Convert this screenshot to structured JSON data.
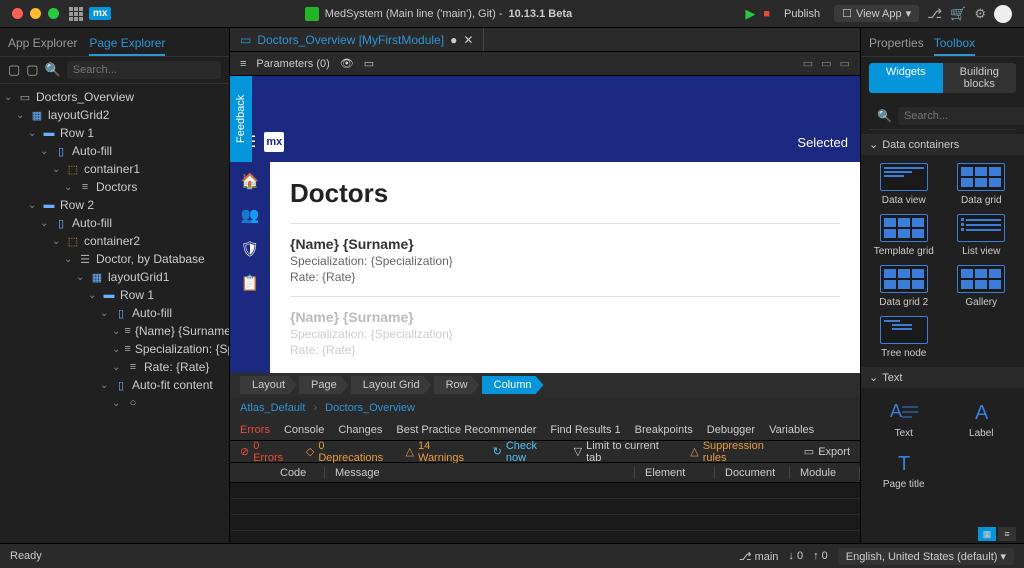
{
  "titlebar": {
    "project": "MedSystem (Main line ('main'), Git) -",
    "version": "10.13.1 Beta",
    "publish": "Publish",
    "view_app": "View App"
  },
  "left": {
    "tabs": [
      "App Explorer",
      "Page Explorer"
    ],
    "active_tab": 1,
    "search_placeholder": "Search...",
    "tree": [
      {
        "d": 0,
        "icon": "page",
        "label": "Doctors_Overview"
      },
      {
        "d": 1,
        "icon": "grid",
        "label": "layoutGrid2"
      },
      {
        "d": 2,
        "icon": "row",
        "label": "Row 1"
      },
      {
        "d": 3,
        "icon": "col",
        "label": "Auto-fill"
      },
      {
        "d": 4,
        "icon": "cont",
        "label": "container1"
      },
      {
        "d": 5,
        "icon": "text",
        "label": "Doctors"
      },
      {
        "d": 2,
        "icon": "row",
        "label": "Row 2"
      },
      {
        "d": 3,
        "icon": "col",
        "label": "Auto-fill"
      },
      {
        "d": 4,
        "icon": "cont",
        "label": "container2"
      },
      {
        "d": 5,
        "icon": "data",
        "label": "Doctor, by Database"
      },
      {
        "d": 6,
        "icon": "grid",
        "label": "layoutGrid1"
      },
      {
        "d": 7,
        "icon": "row",
        "label": "Row 1"
      },
      {
        "d": 8,
        "icon": "col",
        "label": "Auto-fill"
      },
      {
        "d": 9,
        "icon": "text",
        "label": "{Name} {Surname}"
      },
      {
        "d": 9,
        "icon": "text",
        "label": "Specialization: {Specializ"
      },
      {
        "d": 9,
        "icon": "text",
        "label": "Rate: {Rate}"
      },
      {
        "d": 8,
        "icon": "col",
        "label": "Auto-fit content"
      },
      {
        "d": 9,
        "icon": "circle",
        "label": ""
      }
    ]
  },
  "doc": {
    "tab": "Doctors_Overview [MyFirstModule]",
    "params": "Parameters (0)"
  },
  "canvas": {
    "feedback": "Feedback",
    "selected": "Selected",
    "page_title": "Doctors",
    "cards": [
      {
        "title": "{Name} {Surname}",
        "spec": "Specialization: {Specialization}",
        "rate": "Rate: {Rate}",
        "faded": false
      },
      {
        "title": "{Name} {Surname}",
        "spec": "Specialization: {Specialization}",
        "rate": "Rate: {Rate}",
        "faded": true
      }
    ]
  },
  "breadcrumb": [
    "Layout",
    "Page",
    "Layout Grid",
    "Row",
    "Column"
  ],
  "refs": {
    "atlas": "Atlas_Default",
    "page": "Doctors_Overview"
  },
  "bottom_tabs": [
    "Errors",
    "Console",
    "Changes",
    "Best Practice Recommender",
    "Find Results 1",
    "Breakpoints",
    "Debugger",
    "Variables"
  ],
  "bottom_active": 0,
  "errors": {
    "errors": "0 Errors",
    "deprecations": "0 Deprecations",
    "warnings": "14 Warnings",
    "check": "Check now",
    "limit": "Limit to current tab",
    "suppress": "Suppression rules",
    "export": "Export"
  },
  "table_cols": [
    "",
    "Code",
    "Message",
    "Element",
    "Document",
    "Module"
  ],
  "right": {
    "tabs": [
      "Properties",
      "Toolbox"
    ],
    "active_tab": 1,
    "pills": [
      "Widgets",
      "Building blocks"
    ],
    "active_pill": 0,
    "search_placeholder": "Search...",
    "sections": [
      {
        "title": "Data containers",
        "items": [
          {
            "name": "Data view",
            "kind": "view"
          },
          {
            "name": "Data grid",
            "kind": "grid"
          },
          {
            "name": "Template grid",
            "kind": "tgrid"
          },
          {
            "name": "List view",
            "kind": "list"
          },
          {
            "name": "Data grid 2",
            "kind": "grid2"
          },
          {
            "name": "Gallery",
            "kind": "gallery"
          },
          {
            "name": "Tree node",
            "kind": "tree"
          }
        ]
      },
      {
        "title": "Text",
        "items": [
          {
            "name": "Text",
            "kind": "text"
          },
          {
            "name": "Label",
            "kind": "label"
          },
          {
            "name": "Page title",
            "kind": "ptitle"
          }
        ]
      }
    ]
  },
  "status": {
    "ready": "Ready",
    "branch": "main",
    "down": "0",
    "up": "0",
    "lang": "English, United States (default)"
  }
}
